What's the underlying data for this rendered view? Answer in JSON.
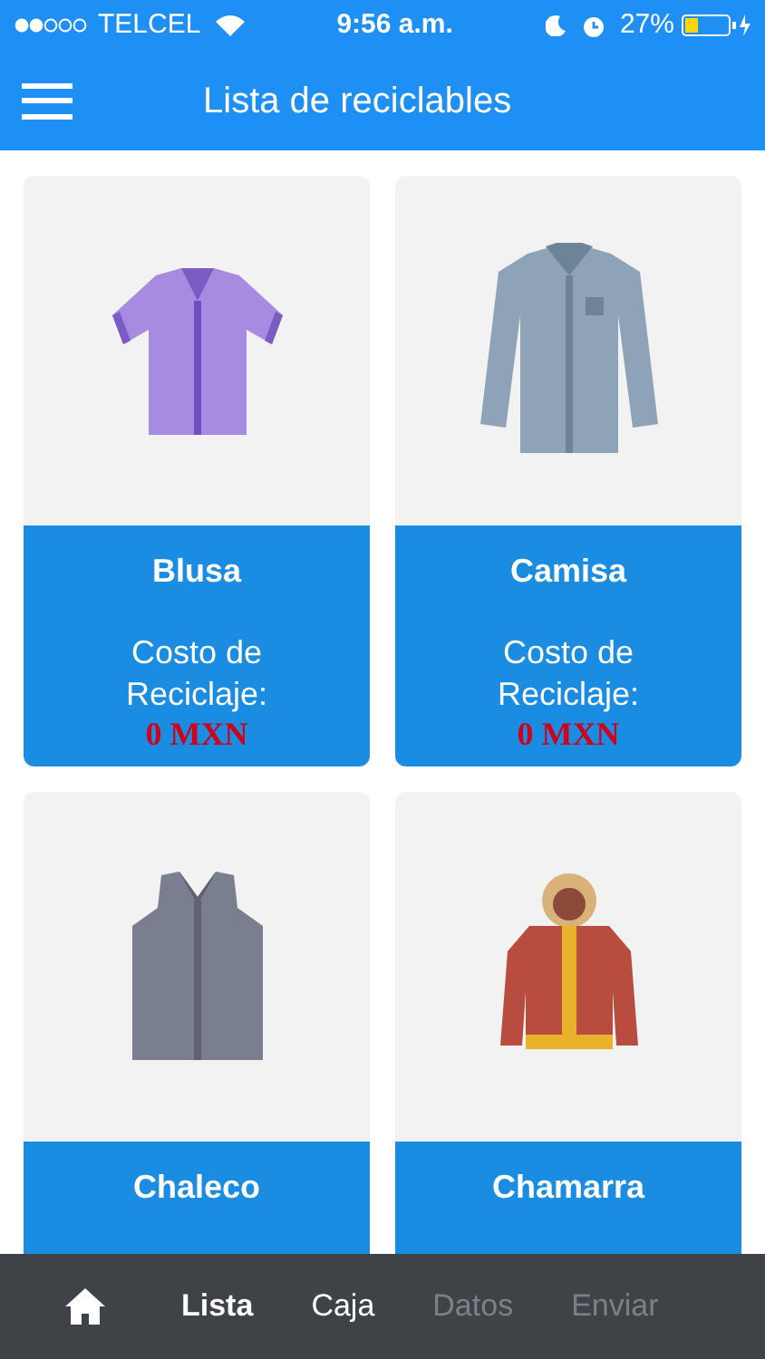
{
  "status_bar": {
    "carrier": "TELCEL",
    "time": "9:56 a.m.",
    "battery": "27%"
  },
  "header": {
    "title": "Lista de reciclables"
  },
  "items": [
    {
      "kind": "blouse",
      "name": "Blusa",
      "cost_label": "Costo de Reciclaje:",
      "cost": "0 MXN"
    },
    {
      "kind": "shirt",
      "name": "Camisa",
      "cost_label": "Costo de Reciclaje:",
      "cost": "0 MXN"
    },
    {
      "kind": "vest",
      "name": "Chaleco"
    },
    {
      "kind": "jacket",
      "name": "Chamarra"
    }
  ],
  "tab_bar": [
    {
      "kind": "home",
      "selected": false,
      "disabled": false
    },
    {
      "label": "Lista",
      "selected": true,
      "disabled": false
    },
    {
      "label": "Caja",
      "selected": false,
      "disabled": false
    },
    {
      "label": "Datos",
      "selected": false,
      "disabled": true
    },
    {
      "label": "Enviar",
      "selected": false,
      "disabled": true
    }
  ]
}
